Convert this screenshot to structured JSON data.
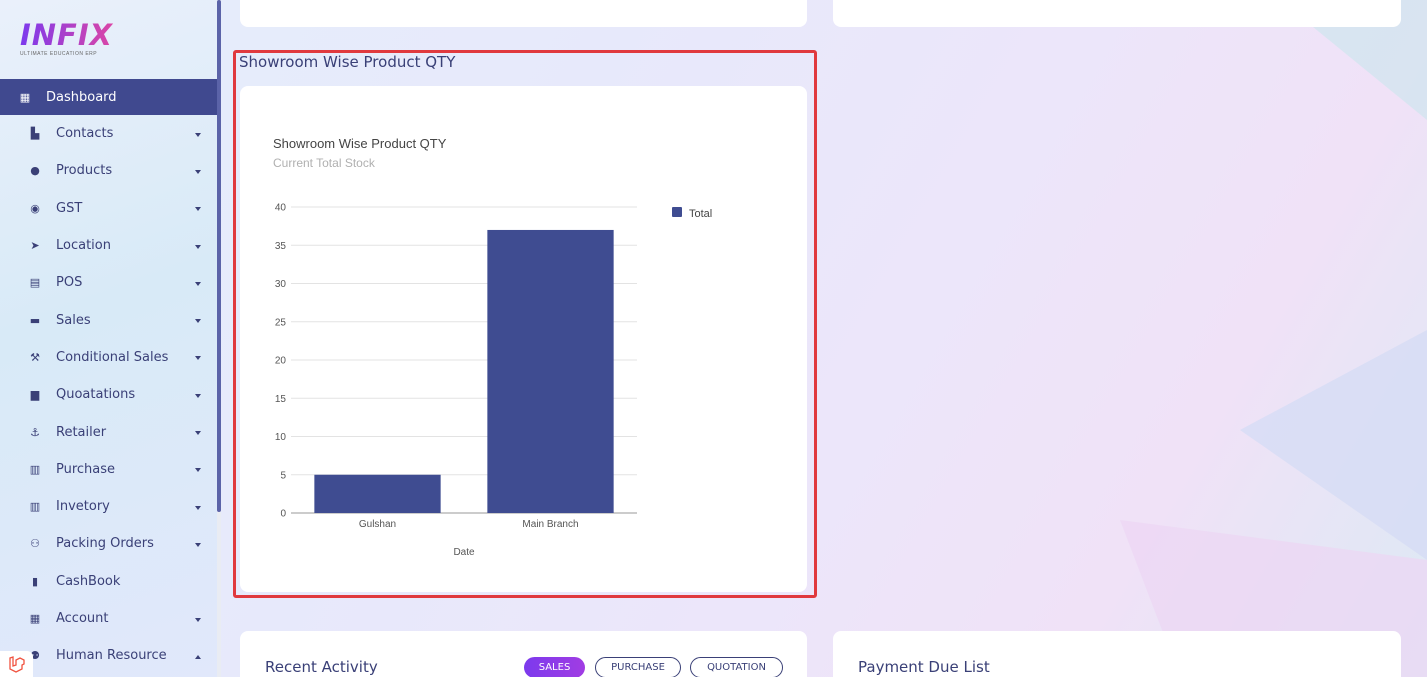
{
  "brand": {
    "logo_text": "INFIX",
    "tagline": "ULTIMATE EDUCATION ERP"
  },
  "sidebar": {
    "items": [
      {
        "label": "Dashboard",
        "icon": "grid-icon",
        "glyph": "▦",
        "active": true,
        "caret": "none"
      },
      {
        "label": "Contacts",
        "icon": "contacts-icon",
        "glyph": "▙",
        "caret": "down"
      },
      {
        "label": "Products",
        "icon": "products-icon",
        "glyph": "●",
        "caret": "down"
      },
      {
        "label": "GST",
        "icon": "gst-icon",
        "glyph": "◉",
        "caret": "down"
      },
      {
        "label": "Location",
        "icon": "location-arrow-icon",
        "glyph": "➤",
        "caret": "down"
      },
      {
        "label": "POS",
        "icon": "cash-register-icon",
        "glyph": "▤",
        "caret": "down"
      },
      {
        "label": "Sales",
        "icon": "store-icon",
        "glyph": "▬",
        "caret": "down"
      },
      {
        "label": "Conditional Sales",
        "icon": "gavel-icon",
        "glyph": "⚒",
        "caret": "down"
      },
      {
        "label": "Quoatations",
        "icon": "mug-icon",
        "glyph": "▆",
        "caret": "down"
      },
      {
        "label": "Retailer",
        "icon": "person-icon",
        "glyph": "⚓",
        "caret": "down"
      },
      {
        "label": "Purchase",
        "icon": "shop-icon",
        "glyph": "▥",
        "caret": "down"
      },
      {
        "label": "Invetory",
        "icon": "bank-icon",
        "glyph": "▥",
        "caret": "down"
      },
      {
        "label": "Packing Orders",
        "icon": "users-icon",
        "glyph": "⚇",
        "caret": "down"
      },
      {
        "label": "CashBook",
        "icon": "book-icon",
        "glyph": "▮",
        "caret": "none"
      },
      {
        "label": "Account",
        "icon": "calculator-icon",
        "glyph": "▦",
        "caret": "down"
      },
      {
        "label": "Human Resource",
        "icon": "user-group-icon",
        "glyph": "⚉",
        "caret": "up"
      }
    ]
  },
  "section": {
    "title": "Showroom Wise Product QTY"
  },
  "chart_data": {
    "type": "bar",
    "title": "Showroom Wise Product QTY",
    "subtitle": "Current Total Stock",
    "categories": [
      "Gulshan",
      "Main Branch"
    ],
    "series": [
      {
        "name": "Total",
        "values": [
          5,
          37
        ]
      }
    ],
    "xlabel": "Date",
    "ylabel": "",
    "ylim": [
      0,
      40
    ],
    "yticks": [
      0,
      5,
      10,
      15,
      20,
      25,
      30,
      35,
      40
    ],
    "grid": true,
    "legend_position": "right",
    "bar_color": "#3f4c91"
  },
  "recent_activity": {
    "title": "Recent Activity",
    "tabs": [
      "SALES",
      "PURCHASE",
      "QUOTATION"
    ]
  },
  "payment_due": {
    "title": "Payment Due List"
  },
  "colors": {
    "primary": "#40498f",
    "accent_gradient_start": "#7c3aed",
    "highlight": "#e0393e"
  }
}
